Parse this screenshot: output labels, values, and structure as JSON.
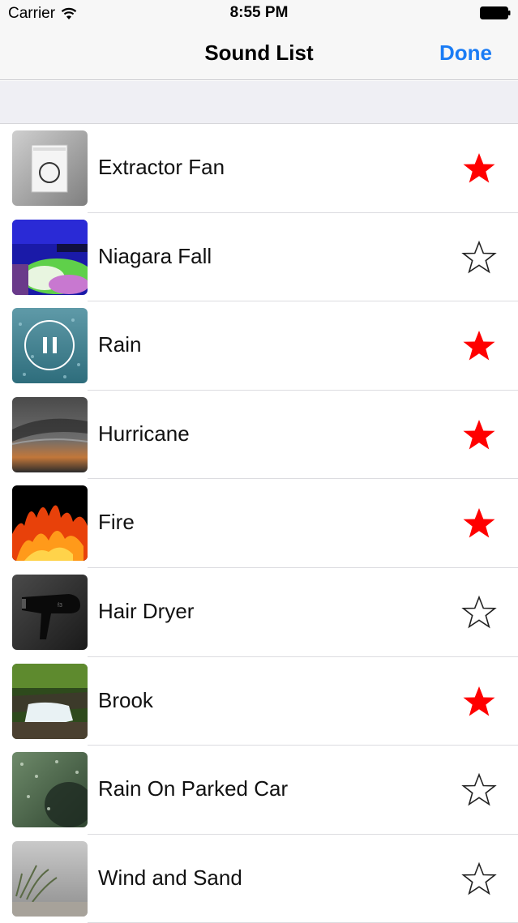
{
  "status": {
    "carrier": "Carrier",
    "time": "8:55 PM"
  },
  "nav": {
    "title": "Sound List",
    "done_label": "Done"
  },
  "colors": {
    "accent": "#1a7cf5",
    "favorite_star": "#ff0000"
  },
  "sounds": [
    {
      "name": "Extractor Fan",
      "favorite": true,
      "icon": "extractor-fan-thumbnail"
    },
    {
      "name": "Niagara Fall",
      "favorite": false,
      "icon": "niagara-fall-thumbnail"
    },
    {
      "name": "Rain",
      "favorite": true,
      "icon": "rain-thumbnail",
      "playing": true
    },
    {
      "name": "Hurricane",
      "favorite": true,
      "icon": "hurricane-thumbnail"
    },
    {
      "name": "Fire",
      "favorite": true,
      "icon": "fire-thumbnail"
    },
    {
      "name": "Hair Dryer",
      "favorite": false,
      "icon": "hair-dryer-thumbnail"
    },
    {
      "name": "Brook",
      "favorite": true,
      "icon": "brook-thumbnail"
    },
    {
      "name": "Rain On Parked Car",
      "favorite": false,
      "icon": "rain-on-parked-car-thumbnail"
    },
    {
      "name": "Wind and Sand",
      "favorite": false,
      "icon": "wind-and-sand-thumbnail"
    }
  ]
}
